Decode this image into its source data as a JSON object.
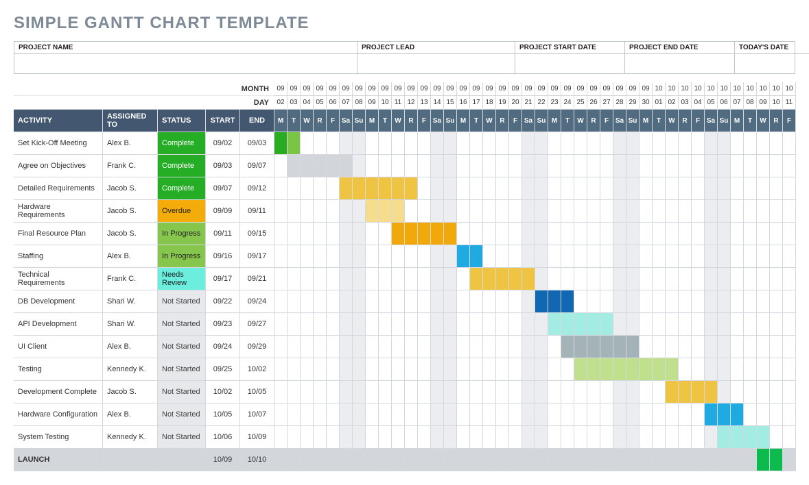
{
  "title": "SIMPLE GANTT CHART TEMPLATE",
  "project_fields": [
    {
      "label": "PROJECT NAME",
      "value": ""
    },
    {
      "label": "PROJECT LEAD",
      "value": ""
    },
    {
      "label": "PROJECT START DATE",
      "value": ""
    },
    {
      "label": "PROJECT END DATE",
      "value": ""
    },
    {
      "label": "TODAY'S DATE",
      "value": ""
    }
  ],
  "labels": {
    "month": "MONTH",
    "day": "DAY",
    "activity": "ACTIVITY",
    "assigned": "ASSIGNED TO",
    "status": "STATUS",
    "start": "START",
    "end": "END"
  },
  "calendar": {
    "months": [
      "09",
      "09",
      "09",
      "09",
      "09",
      "09",
      "09",
      "09",
      "09",
      "09",
      "09",
      "09",
      "09",
      "09",
      "09",
      "09",
      "09",
      "09",
      "09",
      "09",
      "09",
      "09",
      "09",
      "09",
      "09",
      "09",
      "09",
      "09",
      "09",
      "10",
      "10",
      "10",
      "10",
      "10",
      "10",
      "10",
      "10",
      "10",
      "10",
      "10"
    ],
    "days": [
      "02",
      "03",
      "04",
      "05",
      "06",
      "07",
      "08",
      "09",
      "10",
      "11",
      "12",
      "13",
      "14",
      "15",
      "16",
      "17",
      "18",
      "19",
      "20",
      "21",
      "22",
      "23",
      "24",
      "25",
      "26",
      "27",
      "28",
      "29",
      "30",
      "01",
      "02",
      "03",
      "04",
      "05",
      "06",
      "07",
      "08",
      "09",
      "10",
      "11"
    ],
    "dow": [
      "M",
      "T",
      "W",
      "R",
      "F",
      "Sa",
      "Su",
      "M",
      "T",
      "W",
      "R",
      "F",
      "Sa",
      "Su",
      "M",
      "T",
      "W",
      "R",
      "F",
      "Sa",
      "Su",
      "M",
      "T",
      "W",
      "R",
      "F",
      "Sa",
      "Su",
      "M",
      "T",
      "W",
      "R",
      "F",
      "Sa",
      "Su",
      "M",
      "T",
      "W",
      "R",
      "F"
    ]
  },
  "status_colors": {
    "Complete": "st-complete",
    "Overdue": "st-overdue",
    "In Progress": "st-progress",
    "Needs Review": "st-review",
    "Not Started": "st-notstarted"
  },
  "bar_colors": {
    "green_dark": "#2aac22",
    "green_light": "#78c643",
    "grey": "#d2d5da",
    "gold": "#efc443",
    "gold_light": "#f6dd8d",
    "orange": "#f0a80b",
    "blue": "#1faae2",
    "blue_dark": "#1167b2",
    "teal": "#a2ece4",
    "steel": "#a4b3b7",
    "lime": "#c1e08d",
    "emerald": "#0dba4e"
  },
  "tasks": [
    {
      "name": "Set Kick-Off Meeting",
      "assigned": "Alex B.",
      "status": "Complete",
      "start": "09/02",
      "end": "09/03",
      "bar": [
        {
          "from": 0,
          "to": 0,
          "c": "green_dark"
        },
        {
          "from": 1,
          "to": 1,
          "c": "green_light"
        }
      ]
    },
    {
      "name": "Agree on Objectives",
      "assigned": "Frank C.",
      "status": "Complete",
      "start": "09/03",
      "end": "09/07",
      "bar": [
        {
          "from": 1,
          "to": 5,
          "c": "grey"
        }
      ]
    },
    {
      "name": "Detailed Requirements",
      "assigned": "Jacob S.",
      "status": "Complete",
      "start": "09/07",
      "end": "09/12",
      "bar": [
        {
          "from": 5,
          "to": 10,
          "c": "gold"
        }
      ]
    },
    {
      "name": "Hardware Requirements",
      "assigned": "Jacob S.",
      "status": "Overdue",
      "start": "09/09",
      "end": "09/11",
      "bar": [
        {
          "from": 7,
          "to": 9,
          "c": "gold_light"
        }
      ]
    },
    {
      "name": "Final Resource Plan",
      "assigned": "Jacob S.",
      "status": "In Progress",
      "start": "09/11",
      "end": "09/15",
      "bar": [
        {
          "from": 9,
          "to": 13,
          "c": "orange"
        }
      ]
    },
    {
      "name": "Staffing",
      "assigned": "Alex B.",
      "status": "In Progress",
      "start": "09/16",
      "end": "09/17",
      "bar": [
        {
          "from": 14,
          "to": 15,
          "c": "blue"
        }
      ]
    },
    {
      "name": "Technical Requirements",
      "assigned": "Frank C.",
      "status": "Needs Review",
      "start": "09/17",
      "end": "09/21",
      "bar": [
        {
          "from": 15,
          "to": 19,
          "c": "gold"
        }
      ]
    },
    {
      "name": "DB Development",
      "assigned": "Shari W.",
      "status": "Not Started",
      "start": "09/22",
      "end": "09/24",
      "bar": [
        {
          "from": 20,
          "to": 22,
          "c": "blue_dark"
        }
      ]
    },
    {
      "name": "API Development",
      "assigned": "Shari W.",
      "status": "Not Started",
      "start": "09/23",
      "end": "09/27",
      "bar": [
        {
          "from": 21,
          "to": 25,
          "c": "teal"
        }
      ]
    },
    {
      "name": "UI Client",
      "assigned": "Alex B.",
      "status": "Not Started",
      "start": "09/24",
      "end": "09/29",
      "bar": [
        {
          "from": 22,
          "to": 27,
          "c": "steel"
        }
      ]
    },
    {
      "name": "Testing",
      "assigned": "Kennedy K.",
      "status": "Not Started",
      "start": "09/25",
      "end": "10/02",
      "bar": [
        {
          "from": 23,
          "to": 30,
          "c": "lime"
        }
      ]
    },
    {
      "name": "Development Complete",
      "assigned": "Jacob S.",
      "status": "Not Started",
      "start": "10/02",
      "end": "10/05",
      "bar": [
        {
          "from": 30,
          "to": 33,
          "c": "gold"
        }
      ]
    },
    {
      "name": "Hardware Configuration",
      "assigned": "Alex B.",
      "status": "Not Started",
      "start": "10/05",
      "end": "10/07",
      "bar": [
        {
          "from": 33,
          "to": 35,
          "c": "blue"
        }
      ]
    },
    {
      "name": "System Testing",
      "assigned": "Kennedy K.",
      "status": "Not Started",
      "start": "10/06",
      "end": "10/09",
      "bar": [
        {
          "from": 34,
          "to": 37,
          "c": "teal"
        }
      ]
    },
    {
      "name": "LAUNCH",
      "assigned": "",
      "status": "",
      "start": "10/09",
      "end": "10/10",
      "launch": true,
      "bar": [
        {
          "from": 37,
          "to": 38,
          "c": "emerald"
        }
      ]
    }
  ],
  "chart_data": {
    "type": "gantt",
    "x_unit": "day",
    "x_start": "09/02",
    "x_end": "10/11",
    "columns": [
      "09/02",
      "09/03",
      "09/04",
      "09/05",
      "09/06",
      "09/07",
      "09/08",
      "09/09",
      "09/10",
      "09/11",
      "09/12",
      "09/13",
      "09/14",
      "09/15",
      "09/16",
      "09/17",
      "09/18",
      "09/19",
      "09/20",
      "09/21",
      "09/22",
      "09/23",
      "09/24",
      "09/25",
      "09/26",
      "09/27",
      "09/28",
      "09/29",
      "09/30",
      "10/01",
      "10/02",
      "10/03",
      "10/04",
      "10/05",
      "10/06",
      "10/07",
      "10/08",
      "10/09",
      "10/10",
      "10/11"
    ],
    "series": [
      {
        "name": "Set Kick-Off Meeting",
        "assigned": "Alex B.",
        "status": "Complete",
        "start": "09/02",
        "end": "09/03"
      },
      {
        "name": "Agree on Objectives",
        "assigned": "Frank C.",
        "status": "Complete",
        "start": "09/03",
        "end": "09/07"
      },
      {
        "name": "Detailed Requirements",
        "assigned": "Jacob S.",
        "status": "Complete",
        "start": "09/07",
        "end": "09/12"
      },
      {
        "name": "Hardware Requirements",
        "assigned": "Jacob S.",
        "status": "Overdue",
        "start": "09/09",
        "end": "09/11"
      },
      {
        "name": "Final Resource Plan",
        "assigned": "Jacob S.",
        "status": "In Progress",
        "start": "09/11",
        "end": "09/15"
      },
      {
        "name": "Staffing",
        "assigned": "Alex B.",
        "status": "In Progress",
        "start": "09/16",
        "end": "09/17"
      },
      {
        "name": "Technical Requirements",
        "assigned": "Frank C.",
        "status": "Needs Review",
        "start": "09/17",
        "end": "09/21"
      },
      {
        "name": "DB Development",
        "assigned": "Shari W.",
        "status": "Not Started",
        "start": "09/22",
        "end": "09/24"
      },
      {
        "name": "API Development",
        "assigned": "Shari W.",
        "status": "Not Started",
        "start": "09/23",
        "end": "09/27"
      },
      {
        "name": "UI Client",
        "assigned": "Alex B.",
        "status": "Not Started",
        "start": "09/24",
        "end": "09/29"
      },
      {
        "name": "Testing",
        "assigned": "Kennedy K.",
        "status": "Not Started",
        "start": "09/25",
        "end": "10/02"
      },
      {
        "name": "Development Complete",
        "assigned": "Jacob S.",
        "status": "Not Started",
        "start": "10/02",
        "end": "10/05"
      },
      {
        "name": "Hardware Configuration",
        "assigned": "Alex B.",
        "status": "Not Started",
        "start": "10/05",
        "end": "10/07"
      },
      {
        "name": "System Testing",
        "assigned": "Kennedy K.",
        "status": "Not Started",
        "start": "10/06",
        "end": "10/09"
      },
      {
        "name": "LAUNCH",
        "assigned": "",
        "status": "",
        "start": "10/09",
        "end": "10/10"
      }
    ]
  }
}
